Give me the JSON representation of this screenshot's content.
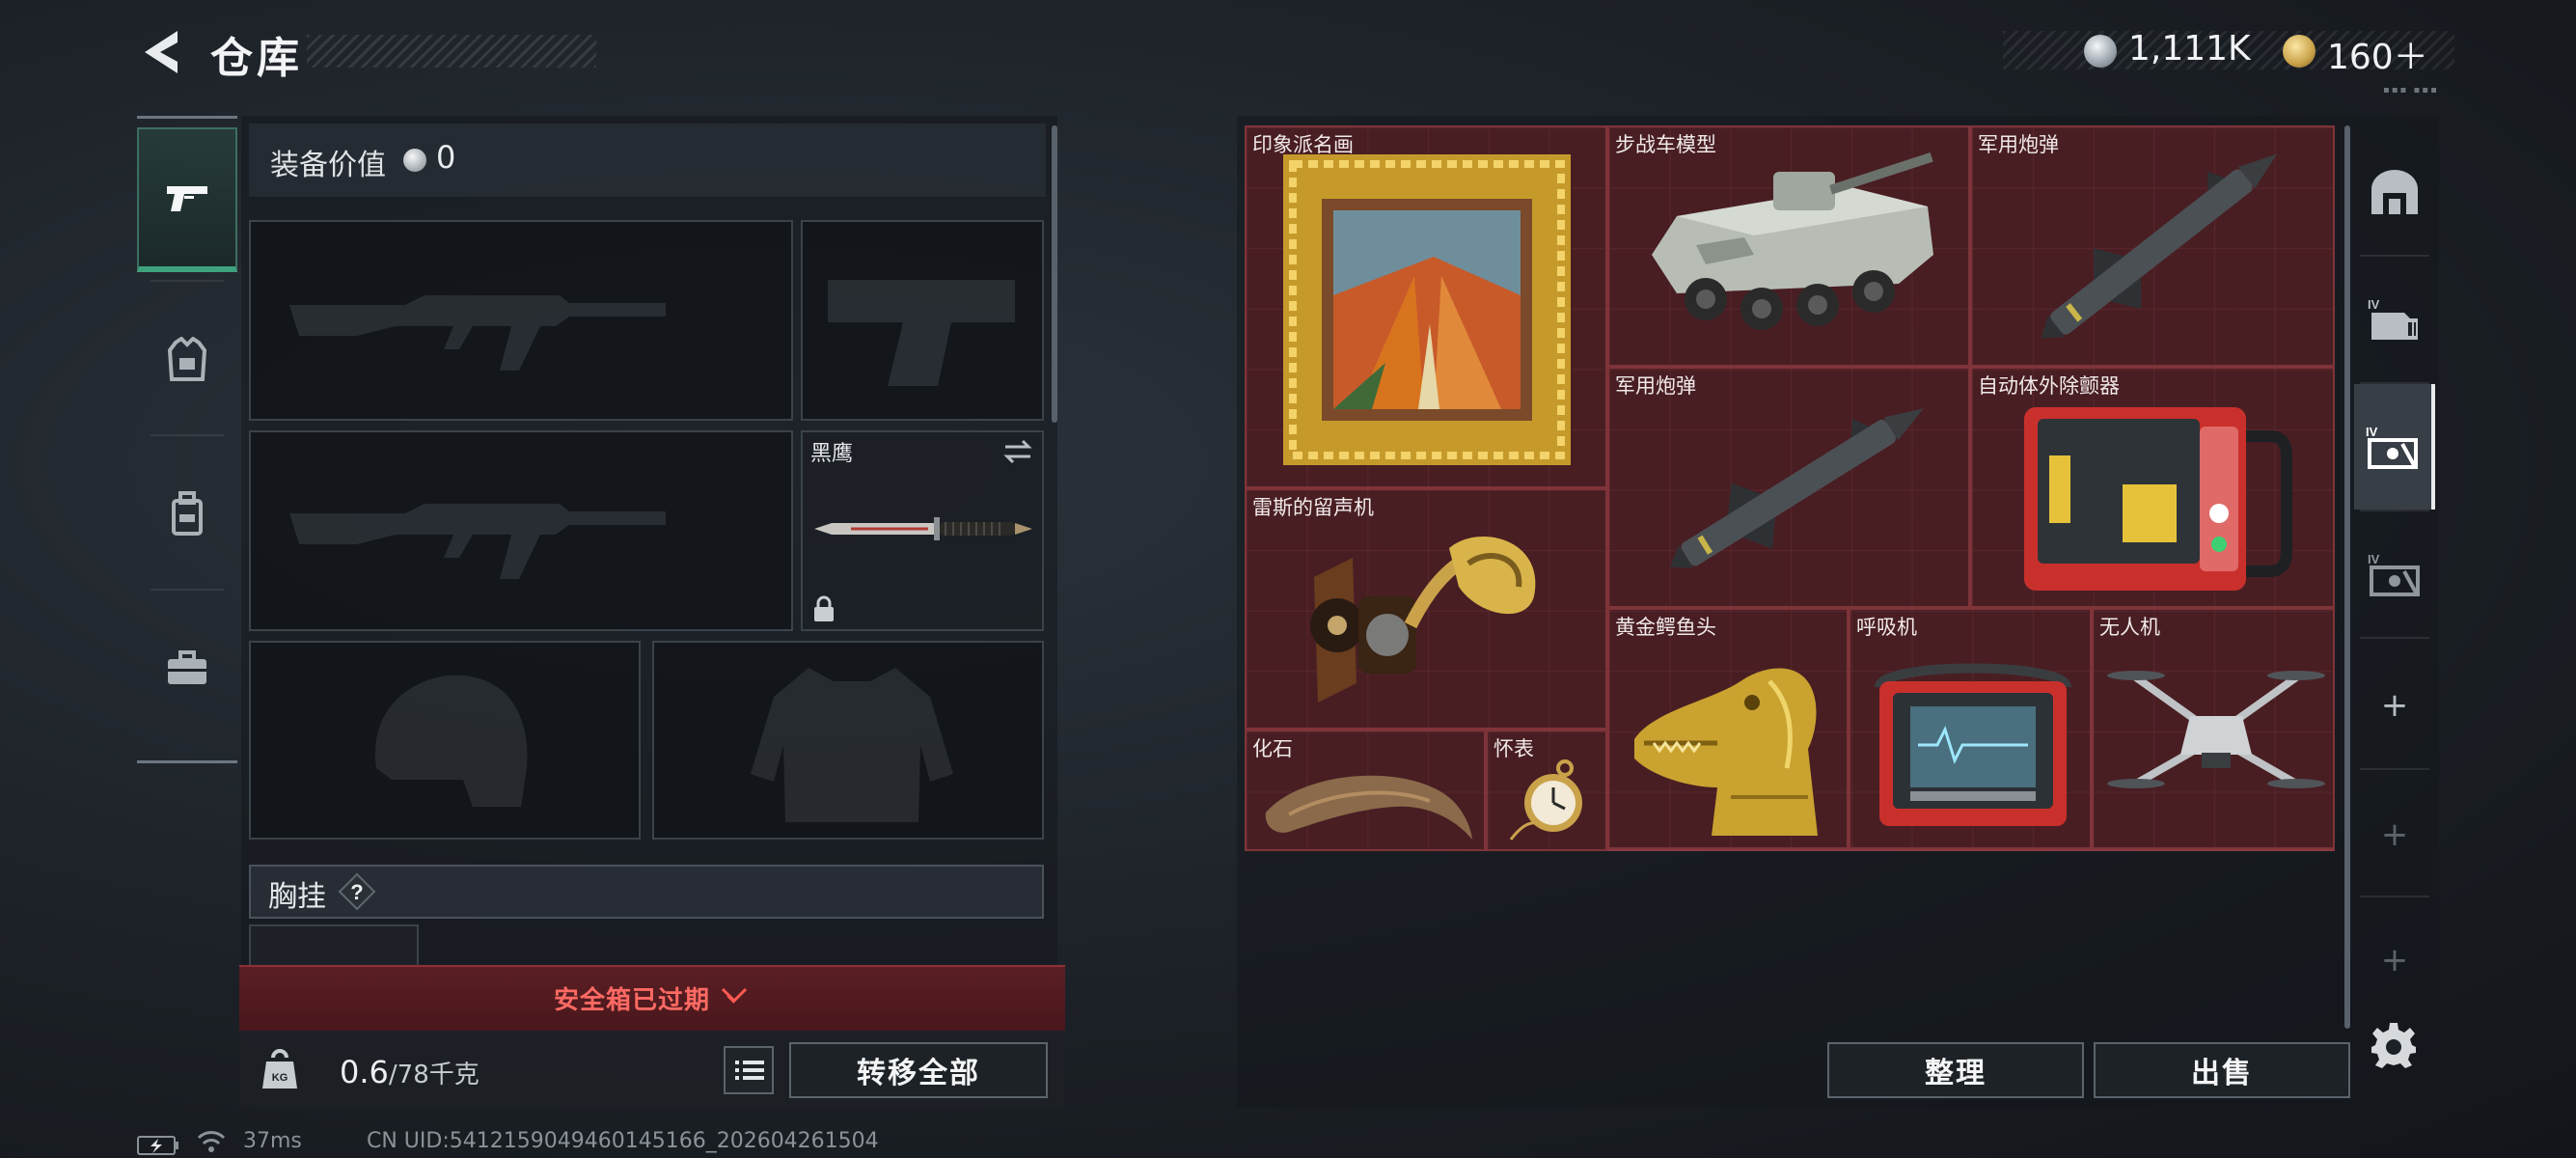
{
  "header": {
    "title": "仓库",
    "currency_silver": "1,111K",
    "currency_gold": "160＋"
  },
  "equipment": {
    "value_label": "装备价值",
    "value": "0",
    "melee_name": "黑鹰",
    "chest_label": "胸挂",
    "chest_help": "?"
  },
  "safe_box": {
    "status": "安全箱已过期"
  },
  "footer": {
    "weight_current": "0.6",
    "weight_max": "/78千克",
    "transfer_all": "转移全部",
    "tidy": "整理",
    "sell": "出售"
  },
  "status_bar": {
    "ping": "37ms",
    "uid": "CN UID:5412159049460145166_202604261504"
  },
  "storage_items": [
    {
      "name": "印象派名画",
      "icon": "framed-painting"
    },
    {
      "name": "步战车模型",
      "icon": "armored-vehicle-model"
    },
    {
      "name": "军用炮弹",
      "icon": "missile"
    },
    {
      "name": "军用炮弹",
      "icon": "missile"
    },
    {
      "name": "自动体外除颤器",
      "icon": "defibrillator"
    },
    {
      "name": "雷斯的留声机",
      "icon": "gramophone"
    },
    {
      "name": "黄金鳄鱼头",
      "icon": "golden-crocodile-head"
    },
    {
      "name": "呼吸机",
      "icon": "ventilator"
    },
    {
      "name": "无人机",
      "icon": "drone"
    },
    {
      "name": "化石",
      "icon": "fossil-claw"
    },
    {
      "name": "怀表",
      "icon": "pocket-watch"
    }
  ],
  "colors": {
    "storage_bg": "#3d1b1f",
    "storage_border": "#8a3b40",
    "safe_bar": "#5a1f24",
    "safe_text": "#ff6a63",
    "active_rail": "#3ea27f"
  }
}
